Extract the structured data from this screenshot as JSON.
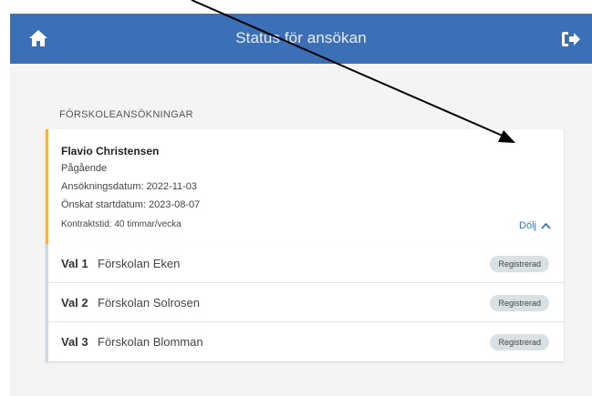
{
  "header": {
    "title": "Status för ansökan",
    "home_icon": "home-icon",
    "logout_icon": "logout-icon",
    "bg_color": "#3b6fb6"
  },
  "section": {
    "title": "FÖRSKOLEANSÖKNINGAR"
  },
  "application": {
    "name": "Flavio Christensen",
    "status": "Pågående",
    "application_date": "Ansökningsdatum: 2022-11-03",
    "desired_start": "Önskat startdatum: 2023-08-07",
    "contract_time": "Kontraktstid: 40 timmar/vecka",
    "toggle_label": "Dölj",
    "accent_color": "#f3b54a"
  },
  "choices": [
    {
      "label": "Val 1",
      "school": "Förskolan Eken",
      "badge": "Registrerad"
    },
    {
      "label": "Val 2",
      "school": "Förskolan Solrosen",
      "badge": "Registrerad"
    },
    {
      "label": "Val 3",
      "school": "Förskolan Blomman",
      "badge": "Registrerad"
    }
  ]
}
